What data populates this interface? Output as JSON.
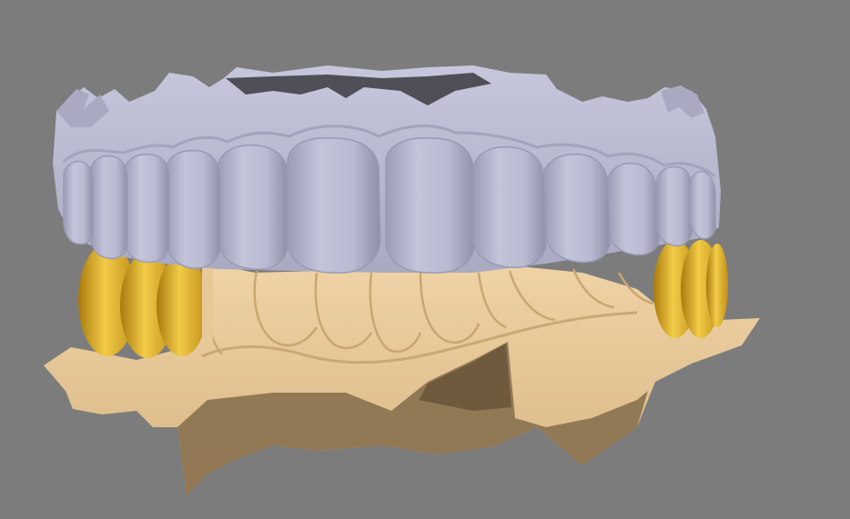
{
  "viewer": {
    "background_color": "#7c7c7c",
    "view": "front",
    "model": {
      "upper_arch": {
        "color": "#b5b6cd",
        "shade": "#8f90a8",
        "cavity": "#4f4f57"
      },
      "lower_arch": {
        "color": "#e8c897",
        "shade": "#c9a673",
        "dark": "#7a6447"
      },
      "bridge_crowns": {
        "color": "#e3b128",
        "shade": "#b78510",
        "highlight": "#f5d15a"
      }
    },
    "icons": [
      "dental-scan-model-icon"
    ]
  }
}
